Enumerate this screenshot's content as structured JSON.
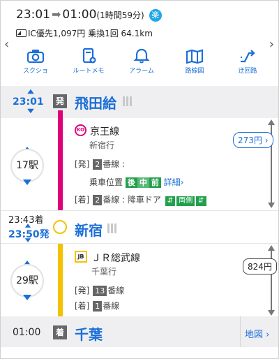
{
  "header": {
    "depart_time": "23:01",
    "arrive_time": "01:00",
    "duration": "(1時間59分)",
    "raku_badge": "楽",
    "fare_summary": "IC優先1,097円 乗換1回 64.1km"
  },
  "toolbar": [
    {
      "label": "スクショ",
      "icon": "camera-icon"
    },
    {
      "label": "ルートメモ",
      "icon": "route-memo-icon"
    },
    {
      "label": "アラーム",
      "icon": "bell-icon"
    },
    {
      "label": "路線図",
      "icon": "route-map-icon"
    },
    {
      "label": "迂回路",
      "icon": "detour-icon"
    }
  ],
  "stations": [
    {
      "time": "23:01",
      "badge": "発",
      "name": "飛田給"
    },
    {
      "arrive_time": "23:43着",
      "depart_time": "23:50発",
      "name": "新宿"
    },
    {
      "time": "01:00",
      "badge": "着",
      "name": "千葉",
      "map_label": "地図"
    }
  ],
  "legs": [
    {
      "line_icon": "KO",
      "line_name": "京王線",
      "direction": "新宿行",
      "stations_count": "17駅",
      "fare": "273円",
      "depart_prefix": "[発]",
      "depart_platform": "2",
      "depart_suffix": "番線 :",
      "car_position_label": "乗車位置",
      "cars": [
        "後",
        "中",
        "前"
      ],
      "detail_label": "詳細",
      "arrive_prefix": "[着]",
      "arrive_platform": "2",
      "arrive_suffix": "番線 : 降車ドア",
      "door_label": "両側"
    },
    {
      "line_icon": "JB",
      "line_name": "ＪＲ総武線",
      "direction": "千葉行",
      "stations_count": "29駅",
      "fare": "824円",
      "depart_prefix": "[発]",
      "depart_platform": "13",
      "depart_suffix": "番線",
      "arrive_prefix": "[着]",
      "arrive_platform": "1",
      "arrive_suffix": "番線"
    }
  ],
  "colors": {
    "accent": "#1c6fd6",
    "keio_line": "#e0007a",
    "sobu_line": "#f2c200",
    "car_green": "#22a04b"
  }
}
